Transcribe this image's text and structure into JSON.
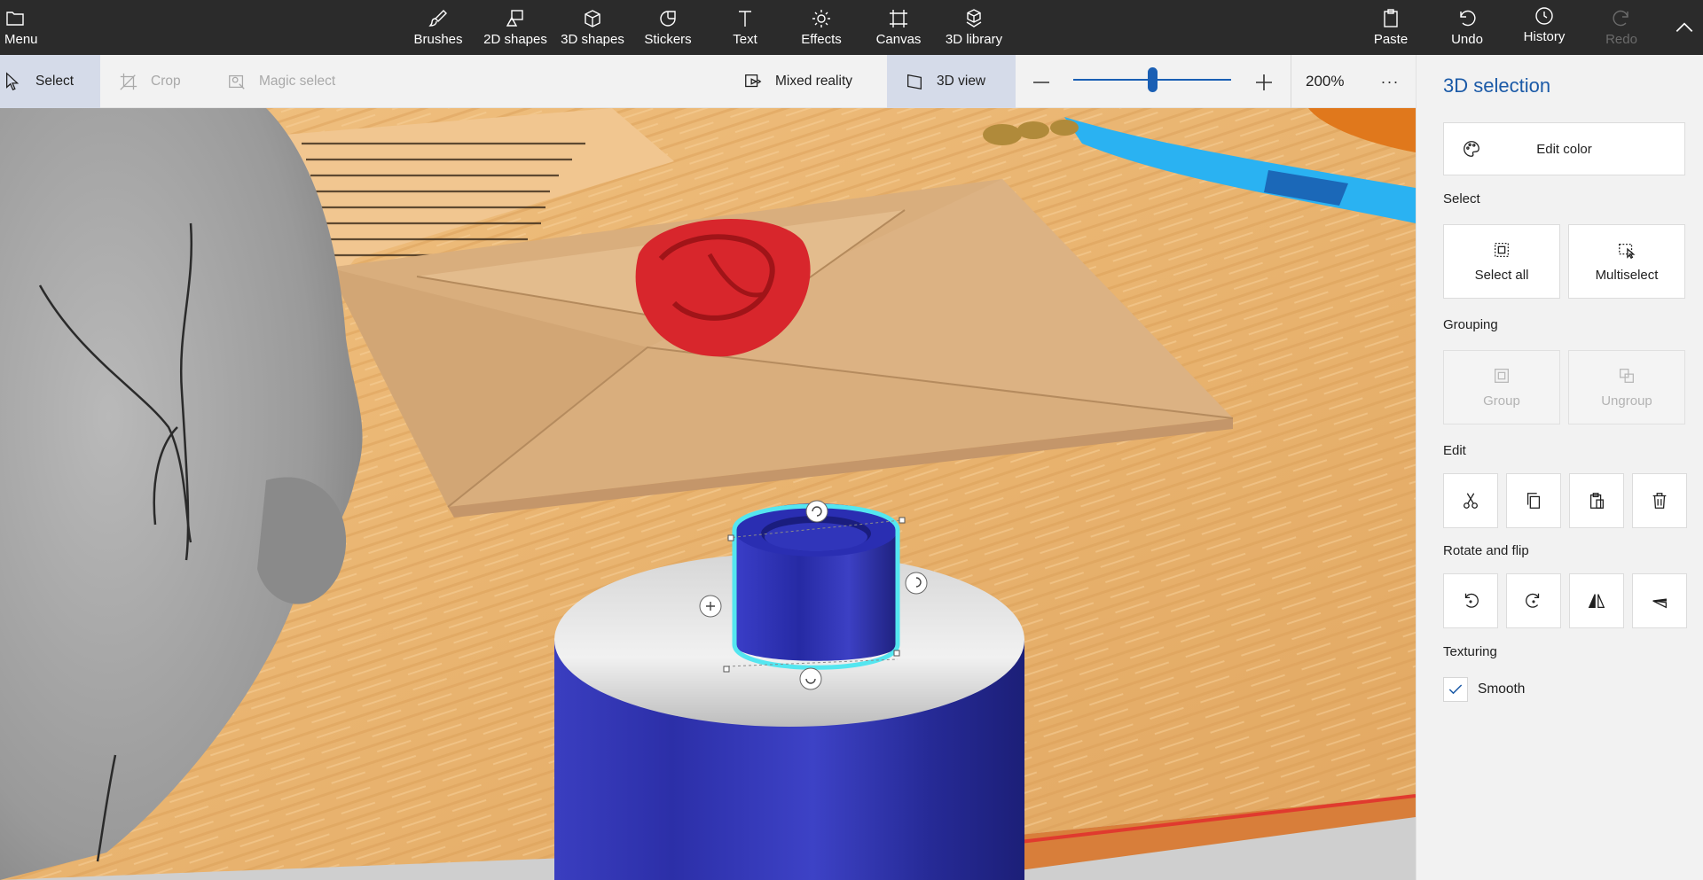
{
  "topbar": {
    "menu_label": "Menu",
    "tools": [
      {
        "label": "Brushes",
        "icon": "brush-icon"
      },
      {
        "label": "2D shapes",
        "icon": "2d-shapes-icon"
      },
      {
        "label": "3D shapes",
        "icon": "3d-shapes-icon"
      },
      {
        "label": "Stickers",
        "icon": "stickers-icon"
      },
      {
        "label": "Text",
        "icon": "text-icon"
      },
      {
        "label": "Effects",
        "icon": "effects-icon"
      },
      {
        "label": "Canvas",
        "icon": "canvas-icon"
      },
      {
        "label": "3D library",
        "icon": "3d-library-icon"
      }
    ],
    "paste_label": "Paste",
    "undo_label": "Undo",
    "history_label": "History",
    "redo_label": "Redo"
  },
  "toolbar": {
    "select_label": "Select",
    "crop_label": "Crop",
    "magic_select_label": "Magic select",
    "mixed_reality_label": "Mixed reality",
    "view_3d_label": "3D view",
    "zoom_level": "200%",
    "zoom_slider_fraction": 0.5,
    "more_label": "···"
  },
  "panel": {
    "title": "3D selection",
    "edit_color_label": "Edit color",
    "select_heading": "Select",
    "select_all_label": "Select all",
    "multiselect_label": "Multiselect",
    "grouping_heading": "Grouping",
    "group_label": "Group",
    "ungroup_label": "Ungroup",
    "edit_heading": "Edit",
    "rotate_flip_heading": "Rotate and flip",
    "texturing_heading": "Texturing",
    "smooth_label": "Smooth",
    "smooth_checked": true
  },
  "colors": {
    "accent": "#1b5aa7",
    "topbar_bg": "#2b2b2b",
    "selection_outline": "#54e6f0",
    "object_blue": "#2c2fb0"
  }
}
